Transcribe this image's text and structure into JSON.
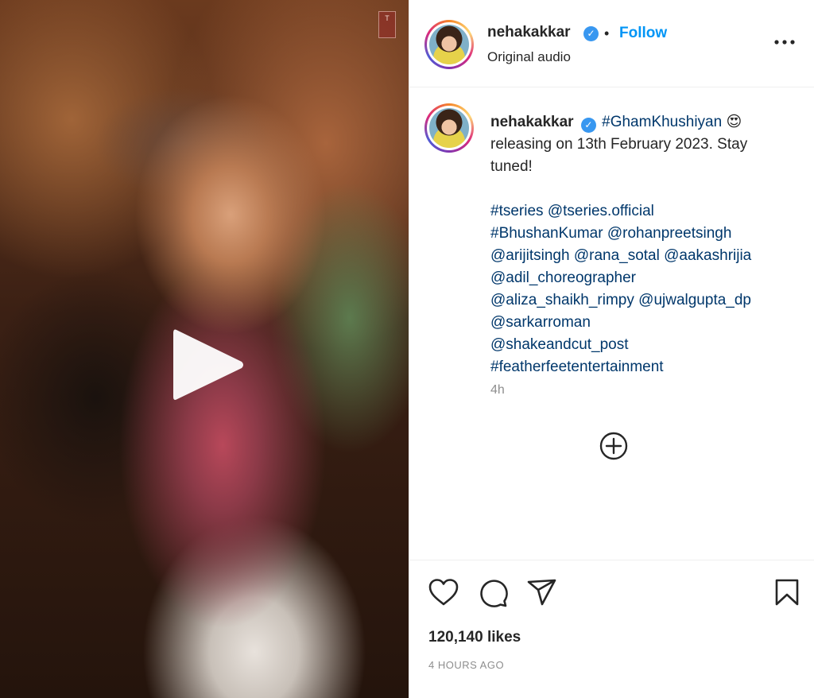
{
  "media": {
    "brand_mark": "T",
    "play_icon": "play-icon"
  },
  "header": {
    "username": "nehakakkar",
    "separator": "•",
    "follow_label": "Follow",
    "audio_label": "Original audio",
    "more_icon": "more-horizontal-icon"
  },
  "caption": {
    "username": "nehakakkar",
    "hashtag_main": "#GhamKhushiyan",
    "emoji": "😍",
    "text_line": " releasing on 13th February 2023. Stay tuned!",
    "tags": [
      "#tseries",
      "@tseries.official",
      "#BhushanKumar",
      "@rohanpreetsingh",
      "@arijitsingh",
      "@rana_sotal",
      "@aakashrijia",
      "@adil_choreographer",
      "@aliza_shaikh_rimpy",
      "@ujwalgupta_dp",
      "@sarkarroman",
      "@shakeandcut_post",
      "#featherfeetentertainment"
    ],
    "time_ago": "4h"
  },
  "actions": {
    "icons": [
      "heart-icon",
      "comment-icon",
      "share-icon",
      "save-icon"
    ],
    "likes": "120,140 likes",
    "timestamp": "4 HOURS AGO"
  },
  "colors": {
    "link": "#00376b",
    "follow": "#0095f6",
    "verified": "#3897f0",
    "muted": "#8e8e8e"
  }
}
